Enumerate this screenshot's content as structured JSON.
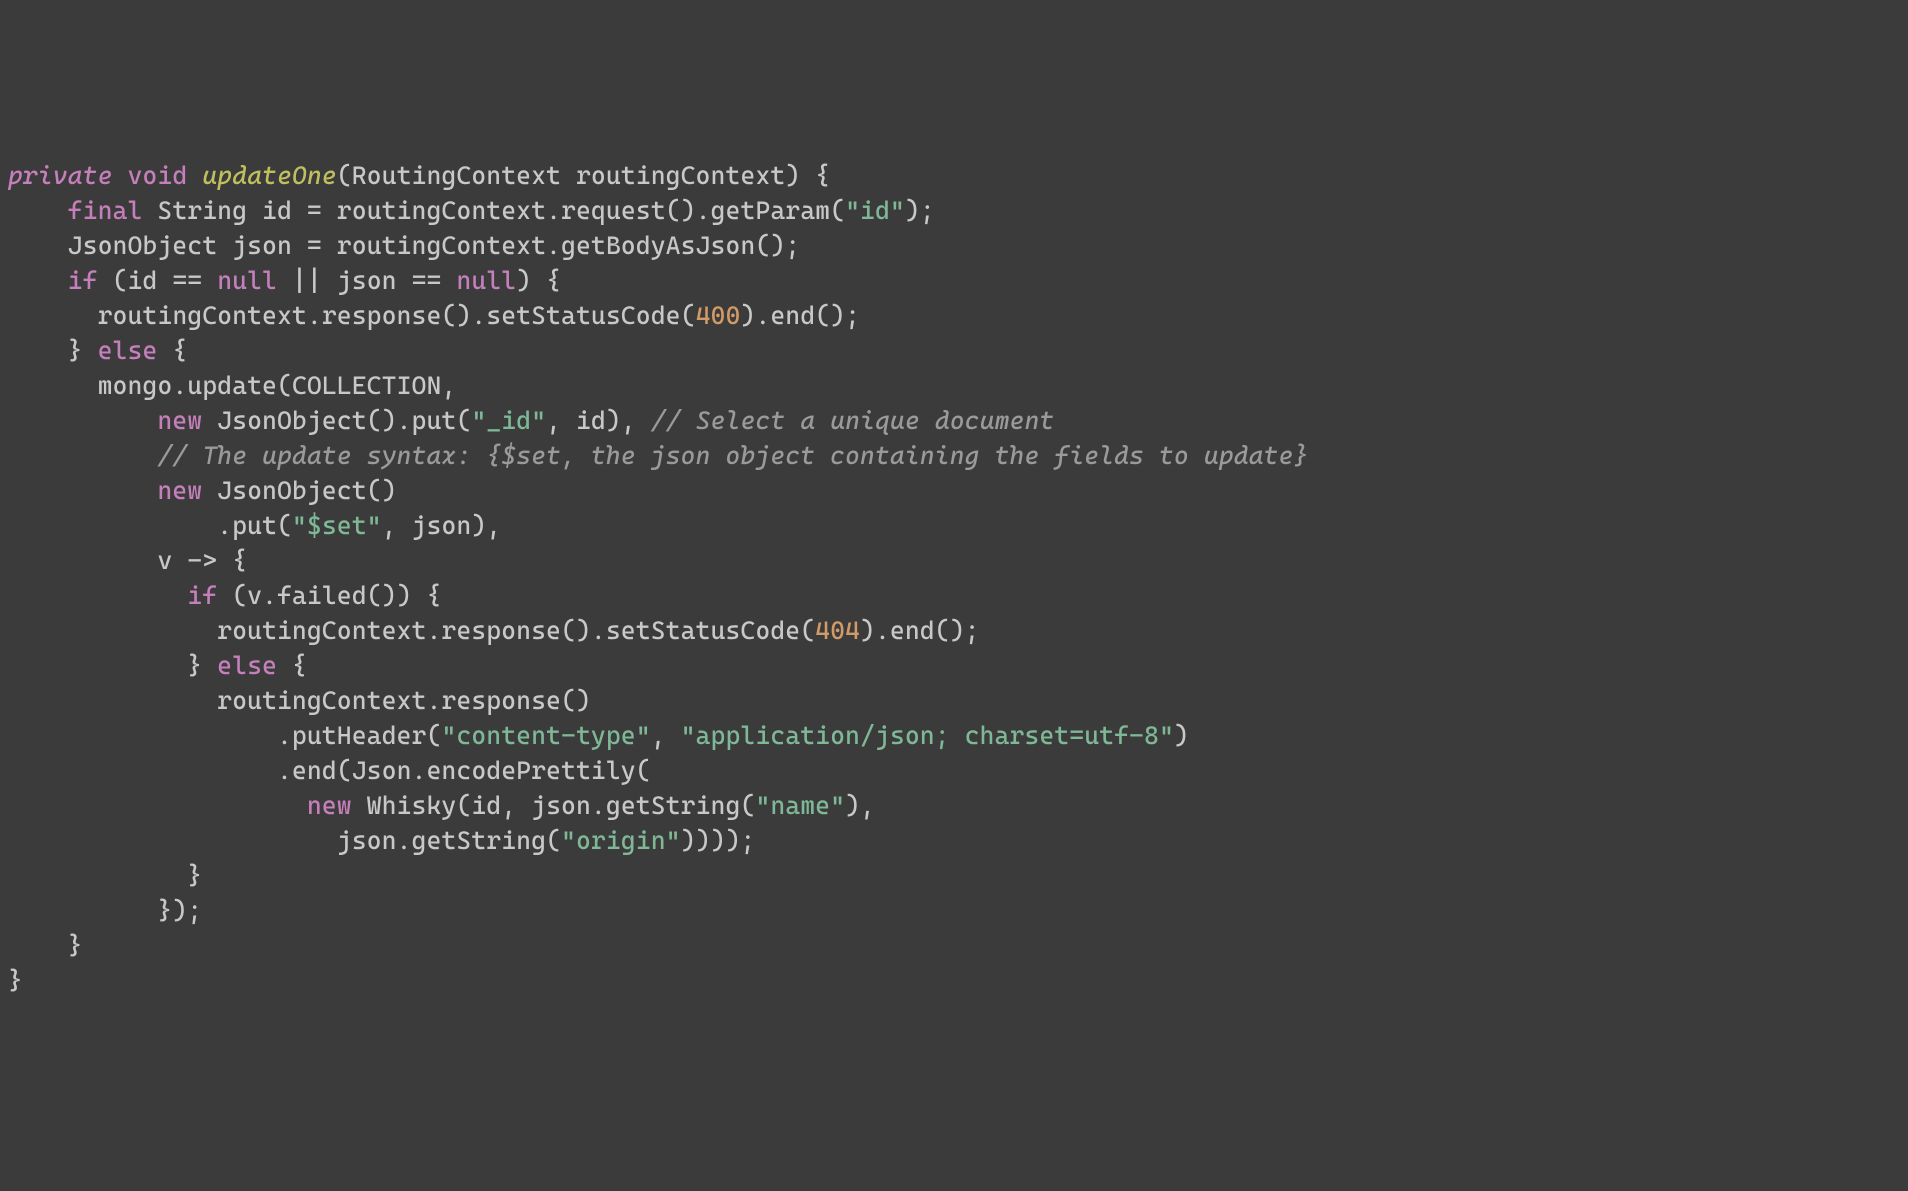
{
  "code": {
    "tokens": {
      "kw_private": "private",
      "kw_void": "void",
      "method_name": "updateOne",
      "type_RoutingContext": "RoutingContext",
      "param_routingContext": "routingContext",
      "kw_final": "final",
      "type_String": "String",
      "var_id": "id",
      "call_request": "request",
      "call_getParam": "getParam",
      "str_id": "\"id\"",
      "type_JsonObject": "JsonObject",
      "var_json": "json",
      "call_getBodyAsJson": "getBodyAsJson",
      "kw_if": "if",
      "kw_null": "null",
      "call_response": "response",
      "call_setStatusCode": "setStatusCode",
      "num_400": "400",
      "call_end": "end",
      "kw_else": "else",
      "var_mongo": "mongo",
      "call_update": "update",
      "const_COLLECTION": "COLLECTION",
      "kw_new": "new",
      "call_put": "put",
      "str_underscore_id": "\"_id\"",
      "comment_select": "// Select a unique document",
      "comment_update_syntax": "// The update syntax: {$set, the json object containing the fields to update}",
      "str_set": "\"$set\"",
      "var_v": "v",
      "arrow": "->",
      "call_failed": "failed",
      "num_404": "404",
      "call_putHeader": "putHeader",
      "str_content_type": "\"content-type\"",
      "str_app_json": "\"application/json; charset=utf-8\"",
      "type_Json": "Json",
      "call_encodePrettily": "encodePrettily",
      "type_Whisky": "Whisky",
      "call_getString": "getString",
      "str_name": "\"name\"",
      "str_origin": "\"origin\""
    }
  }
}
